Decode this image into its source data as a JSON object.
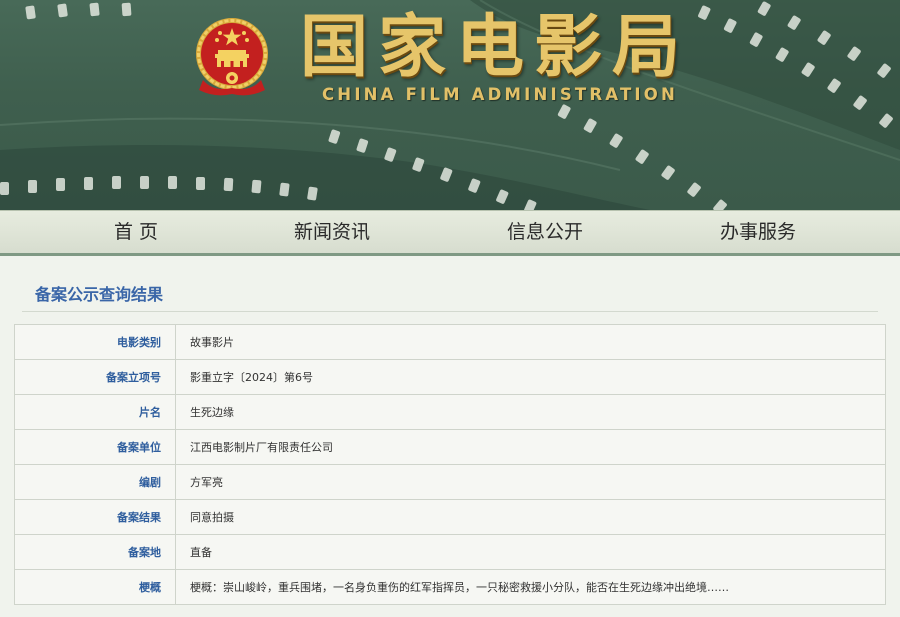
{
  "header": {
    "title_cn": "国家电影局",
    "title_en": "CHINA FILM ADMINISTRATION",
    "emblem_icon": "national-emblem-icon",
    "colors": {
      "banner_green": "#3f5f4e",
      "title_gold": "#e6c56a"
    }
  },
  "nav": {
    "items": [
      {
        "label": "首 页"
      },
      {
        "label": "新闻资讯"
      },
      {
        "label": "信息公开"
      },
      {
        "label": "办事服务"
      }
    ]
  },
  "main": {
    "section_title": "备案公示查询结果",
    "rows": [
      {
        "label": "电影类别",
        "value": "故事影片"
      },
      {
        "label": "备案立项号",
        "value": "影重立字〔2024〕第6号"
      },
      {
        "label": "片名",
        "value": "生死边缘"
      },
      {
        "label": "备案单位",
        "value": "江西电影制片厂有限责任公司"
      },
      {
        "label": "编剧",
        "value": "方军亮"
      },
      {
        "label": "备案结果",
        "value": "同意拍摄"
      },
      {
        "label": "备案地",
        "value": "直备"
      },
      {
        "label": "梗概",
        "value": "梗概：崇山峻岭，重兵围堵，一名身负重伤的红军指挥员，一只秘密救援小分队，能否在生死边缘冲出绝境……"
      }
    ],
    "colors": {
      "label_blue": "#2f5e9e",
      "title_blue": "#3a66a8"
    }
  }
}
